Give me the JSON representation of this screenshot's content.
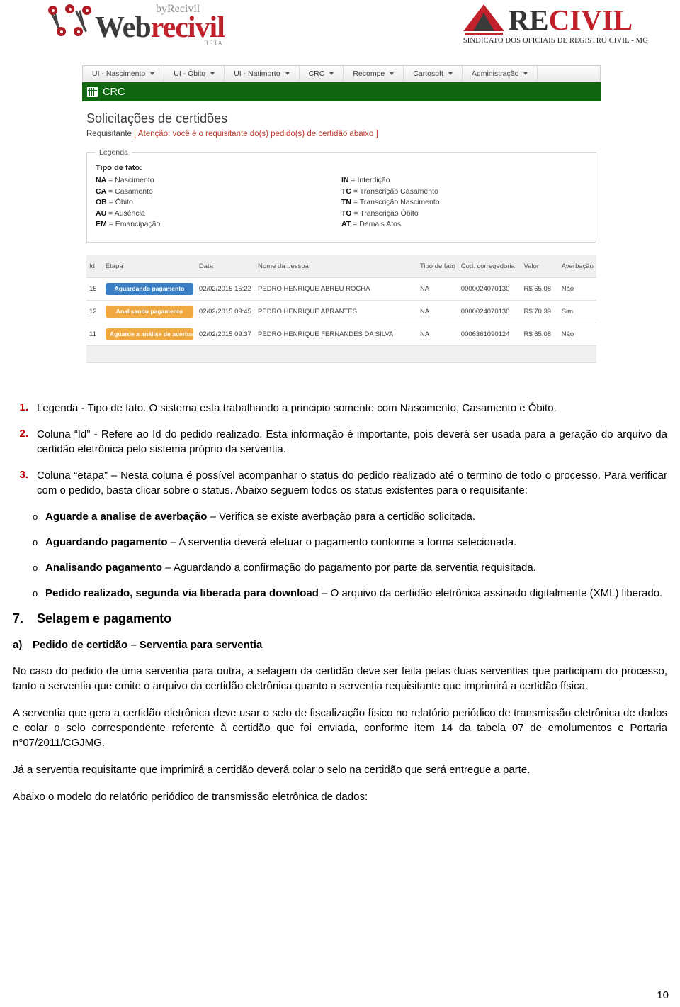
{
  "header": {
    "webrecivil": {
      "by": "byRecivil",
      "word_dark": "Web",
      "word_red": "recivil",
      "beta": "BETA"
    },
    "recivil": {
      "word_dark": "RE",
      "word_red": "CIVIL",
      "subtitle": "SINDICATO DOS OFICIAIS DE REGISTRO CIVIL - MG"
    }
  },
  "app": {
    "menu": [
      {
        "label": "UI - Nascimento"
      },
      {
        "label": "UI - Óbito"
      },
      {
        "label": "UI - Natimorto"
      },
      {
        "label": "CRC"
      },
      {
        "label": "Recompe"
      },
      {
        "label": "Cartosoft"
      },
      {
        "label": "Administração"
      }
    ],
    "module_bar": {
      "label": "CRC",
      "color": "#116611"
    },
    "title": "Solicitações de certidões",
    "subtitle_label": "Requisitante",
    "subtitle_warning": "[ Atenção: você é o requisitante do(s) pedido(s) de certidão abaixo ]",
    "legend": {
      "box_label": "Legenda",
      "title": "Tipo de fato:",
      "left": [
        {
          "code": "NA",
          "desc": "Nascimento"
        },
        {
          "code": "CA",
          "desc": "Casamento"
        },
        {
          "code": "OB",
          "desc": "Óbito"
        },
        {
          "code": "AU",
          "desc": "Ausência"
        },
        {
          "code": "EM",
          "desc": "Emancipação"
        }
      ],
      "right": [
        {
          "code": "IN",
          "desc": "Interdição"
        },
        {
          "code": "TC",
          "desc": "Transcrição Casamento"
        },
        {
          "code": "TN",
          "desc": "Transcrição Nascimento"
        },
        {
          "code": "TO",
          "desc": "Transcrição Óbito"
        },
        {
          "code": "AT",
          "desc": "Demais Atos"
        }
      ]
    },
    "table": {
      "columns": [
        "Id",
        "Etapa",
        "Data",
        "Nome da pessoa",
        "Tipo de fato",
        "Cod. corregedoria",
        "Valor",
        "Averbação"
      ],
      "rows": [
        {
          "id": "15",
          "etapa": "Aguardando pagamento",
          "etapa_color": "#3a7fc4",
          "data": "02/02/2015 15:22",
          "nome": "PEDRO HENRIQUE ABREU ROCHA",
          "tipo": "NA",
          "cod": "0000024070130",
          "valor": "R$ 65,08",
          "averbacao": "Não"
        },
        {
          "id": "12",
          "etapa": "Analisando pagamento",
          "etapa_color": "#f0a840",
          "data": "02/02/2015 09:45",
          "nome": "PEDRO HENRIQUE ABRANTES",
          "tipo": "NA",
          "cod": "0000024070130",
          "valor": "R$ 70,39",
          "averbacao": "Sim"
        },
        {
          "id": "11",
          "etapa": "Aguarde a análise de averbação",
          "etapa_color": "#f0a840",
          "data": "02/02/2015 09:37",
          "nome": "PEDRO HENRIQUE FERNANDES DA SILVA",
          "tipo": "NA",
          "cod": "0006361090124",
          "valor": "R$ 65,08",
          "averbacao": "Não"
        }
      ]
    }
  },
  "doc": {
    "items": [
      {
        "num": "1.",
        "text": "Legenda - Tipo de fato. O sistema esta trabalhando a principio somente com Nascimento, Casamento e Óbito."
      },
      {
        "num": "2.",
        "text": "Coluna “Id” - Refere ao Id do pedido realizado. Esta informação é importante, pois deverá ser usada para a geração do arquivo da certidão eletrônica pelo sistema próprio da serventia."
      },
      {
        "num": "3.",
        "text": "Coluna “etapa” – Nesta coluna é possível acompanhar o status do pedido realizado até o termino de todo o processo. Para verificar com o pedido, basta clicar sobre o status. Abaixo seguem todos os status existentes para o requisitante:"
      }
    ],
    "bullets": [
      {
        "marker": "o",
        "bold": "Aguarde a analise de averbação",
        "rest": " – Verifica se existe averbação para a certidão solicitada."
      },
      {
        "marker": "o",
        "bold": "Aguardando pagamento",
        "rest": " – A serventia deverá efetuar o pagamento conforme a forma selecionada."
      },
      {
        "marker": "o",
        "bold": "Analisando pagamento",
        "rest": " – Aguardando a confirmação do pagamento por parte da serventia requisitada."
      },
      {
        "marker": "o",
        "bold": "Pedido realizado, segunda via liberada para download",
        "rest": " – O arquivo da certidão eletrônica assinado digitalmente (XML) liberado."
      }
    ],
    "section": {
      "num": "7.",
      "title": "Selagem e pagamento"
    },
    "subsection": {
      "letter": "a)",
      "title": "Pedido de certidão – Serventia para serventia"
    },
    "paragraphs": [
      "No caso do pedido de uma serventia para outra, a selagem da certidão deve ser feita pelas duas serventias que participam do processo, tanto a serventia que emite o arquivo da certidão eletrônica quanto a serventia requisitante que imprimirá a certidão física.",
      "A serventia que gera a certidão eletrônica deve usar o selo de fiscalização físico no relatório periódico de transmissão eletrônica de dados e colar o selo correspondente referente à certidão que foi enviada, conforme item 14 da tabela 07 de emolumentos e Portaria n°07/2011/CGJMG.",
      "Já a serventia requisitante que imprimirá a certidão deverá colar o selo na certidão que será entregue a parte.",
      "Abaixo o modelo do relatório periódico de transmissão eletrônica de dados:"
    ],
    "page_number": "10"
  }
}
